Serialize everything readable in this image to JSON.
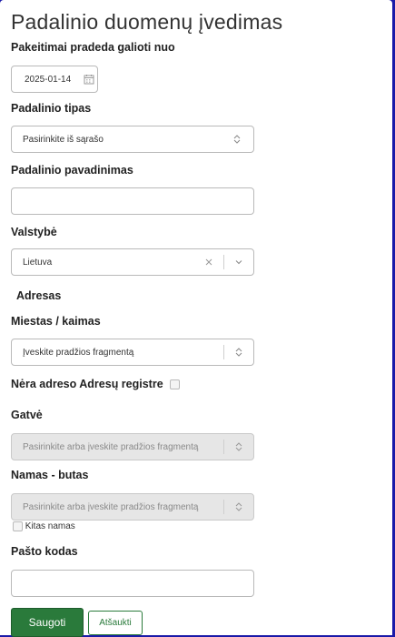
{
  "form": {
    "title": "Padalinio duomenų įvedimas",
    "effective_from": {
      "label": "Pakeitimai pradeda galioti nuo",
      "value": "2025-01-14"
    },
    "unit_type": {
      "label": "Padalinio tipas",
      "value": "Pasirinkite iš sąrašo"
    },
    "unit_name": {
      "label": "Padalinio pavadinimas",
      "value": ""
    },
    "country": {
      "label": "Valstybė",
      "value": "Lietuva"
    },
    "address_section": "Adresas",
    "city": {
      "label": "Miestas / kaimas",
      "placeholder": "Įveskite pradžios fragmentą"
    },
    "no_register": {
      "label": "Nėra adreso Adresų registre"
    },
    "street": {
      "label": "Gatvė",
      "placeholder": "Pasirinkite arba įveskite pradžios fragmentą"
    },
    "house": {
      "label": "Namas - butas",
      "placeholder": "Pasirinkite arba įveskite pradžios fragmentą"
    },
    "other_house": {
      "label": "Kitas namas"
    },
    "postal_code": {
      "label": "Pašto kodas",
      "value": ""
    },
    "buttons": {
      "save": "Saugoti",
      "cancel": "Atšaukti"
    }
  },
  "icons": {
    "calendar": "calendar-icon",
    "updown": "chevron-updown-icon",
    "clear": "clear-x-icon",
    "chevron": "chevron-down-icon"
  },
  "colors": {
    "background": "#1a1aa8",
    "primary": "#2a7a3b"
  }
}
